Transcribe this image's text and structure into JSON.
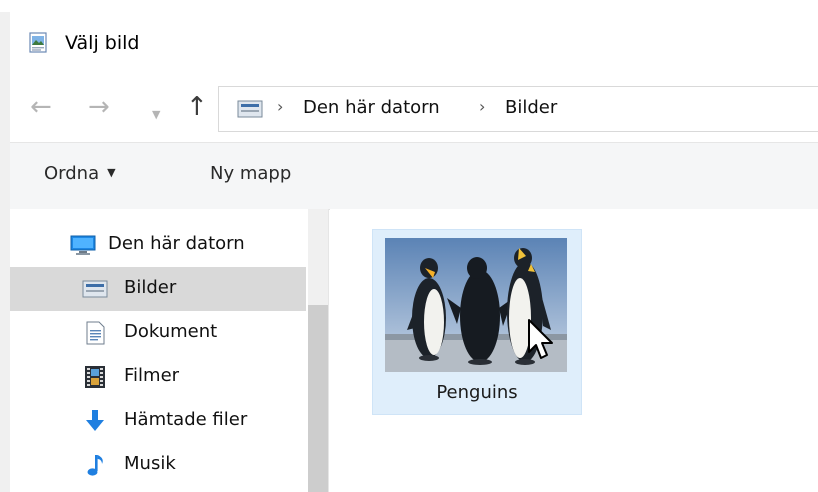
{
  "window": {
    "title": "Välj bild"
  },
  "nav": {
    "back_icon": "arrow-left-icon",
    "forward_icon": "arrow-right-icon",
    "up_icon": "arrow-up-icon",
    "breadcrumb": [
      "Den här datorn",
      "Bilder"
    ]
  },
  "toolbar": {
    "organize_label": "Ordna",
    "new_folder_label": "Ny mapp"
  },
  "sidebar": {
    "items": [
      {
        "label": "Den här datorn",
        "icon": "computer-icon",
        "selected": false
      },
      {
        "label": "Bilder",
        "icon": "pictures-folder-icon",
        "selected": true
      },
      {
        "label": "Dokument",
        "icon": "documents-icon",
        "selected": false
      },
      {
        "label": "Filmer",
        "icon": "film-icon",
        "selected": false
      },
      {
        "label": "Hämtade filer",
        "icon": "download-icon",
        "selected": false
      },
      {
        "label": "Musik",
        "icon": "music-icon",
        "selected": false
      }
    ]
  },
  "files": [
    {
      "name": "Penguins",
      "selected": true
    }
  ],
  "colors": {
    "selection_tile": "#dfeefb",
    "selected_nav": "#d9d9d9",
    "accent": "#1e78d6"
  }
}
